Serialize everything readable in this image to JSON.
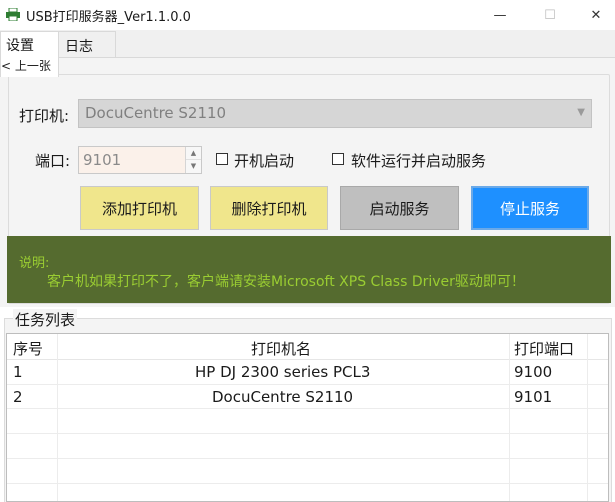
{
  "window": {
    "title": "USB打印服务器_Ver1.1.0.0",
    "min_glyph": "—",
    "max_glyph": "☐",
    "close_glyph": "✕"
  },
  "tabs": {
    "settings": "设置",
    "log": "日志",
    "prev_label": "上一张",
    "prev_glyph": "<"
  },
  "printer": {
    "label": "打印机:",
    "selected": "DocuCentre S2110"
  },
  "port": {
    "label": "端口:",
    "value": "9101"
  },
  "options": {
    "autostart": {
      "label": "开机启动",
      "checked": false
    },
    "run_and_start": {
      "label": "软件运行并启动服务",
      "checked": false
    }
  },
  "buttons": {
    "add": "添加打印机",
    "delete": "删除打印机",
    "start": "启动服务",
    "stop": "停止服务"
  },
  "notice": {
    "title": "说明:",
    "text": "客户机如果打印不了，客户端请安装Microsoft XPS Class Driver驱动即可！"
  },
  "tasks": {
    "title": "任务列表",
    "columns": [
      "序号",
      "打印机名",
      "打印端口"
    ],
    "rows": [
      [
        "1",
        "HP DJ 2300 series PCL3",
        "9100"
      ],
      [
        "2",
        "DocuCentre S2110",
        "9101"
      ]
    ]
  },
  "colors": {
    "add_delete_button": "#f0e68c",
    "start_button": "#bfbfbf",
    "stop_button": "#1e90ff",
    "notice_bg": "#556b2f",
    "notice_text": "#9acd32"
  }
}
